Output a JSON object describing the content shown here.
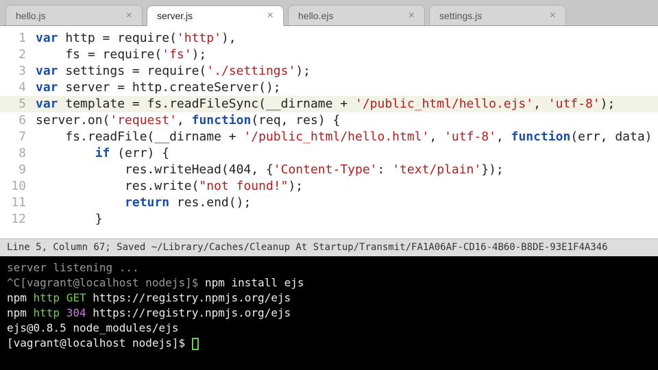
{
  "tabs": [
    {
      "label": "hello.js",
      "active": false
    },
    {
      "label": "server.js",
      "active": true
    },
    {
      "label": "hello.ejs",
      "active": false
    },
    {
      "label": "settings.js",
      "active": false
    }
  ],
  "close_glyph": "×",
  "code": {
    "l1": {
      "kw1": "var",
      "t1": " http = require(",
      "s1": "'http'",
      "t2": "),"
    },
    "l2": {
      "t1": "    fs = require(",
      "s1": "'fs'",
      "t2": ");"
    },
    "l3": {
      "kw1": "var",
      "t1": " settings = require(",
      "s1": "'./settings'",
      "t2": ");"
    },
    "l4": {
      "kw1": "var",
      "t1": " server = http.createServer();"
    },
    "l5": {
      "kw1": "var",
      "t1": " template = fs.readFileSync(__dirname + ",
      "s1": "'/public_html/hello.ejs'",
      "t2": ", ",
      "s2": "'utf-8'",
      "t3": ");"
    },
    "l6": {
      "t1": "server.on(",
      "s1": "'request'",
      "t2": ", ",
      "kw1": "function",
      "t3": "(req, res) {"
    },
    "l7": {
      "t1": "    fs.readFile(__dirname + ",
      "s1": "'/public_html/hello.html'",
      "t2": ", ",
      "s2": "'utf-8'",
      "t3": ", ",
      "kw1": "function",
      "t4": "(err, data) {"
    },
    "l8": {
      "t1": "        ",
      "kw1": "if",
      "t2": " (err) {"
    },
    "l9": {
      "t1": "            res.writeHead(404, {",
      "s1": "'Content-Type'",
      "t2": ": ",
      "s2": "'text/plain'",
      "t3": "});"
    },
    "l10": {
      "t1": "            res.write(",
      "s1": "\"not found!\"",
      "t2": ");"
    },
    "l11": {
      "t1": "            ",
      "kw1": "return",
      "t2": " res.end();"
    },
    "l12": {
      "t1": "        }"
    }
  },
  "line_numbers": [
    "1",
    "2",
    "3",
    "4",
    "5",
    "6",
    "7",
    "8",
    "9",
    "10",
    "11",
    "12"
  ],
  "status_bar": "Line 5, Column 67; Saved ~/Library/Caches/Cleanup At Startup/Transmit/FA1A06AF-CD16-4B60-B8DE-93E1F4A346",
  "terminal": {
    "l1": "server listening ...",
    "l2_a": "^C[vagrant@localhost nodejs]$ ",
    "l2_b": "npm install ejs",
    "l3_a": "npm ",
    "l3_b": "http ",
    "l3_c": "GET ",
    "l3_d": "https://registry.npmjs.org/ejs",
    "l4_a": "npm ",
    "l4_b": "http ",
    "l4_c": "304 ",
    "l4_d": "https://registry.npmjs.org/ejs",
    "l5": "ejs@0.8.5 node_modules/ejs",
    "l6": "[vagrant@localhost nodejs]$ "
  }
}
